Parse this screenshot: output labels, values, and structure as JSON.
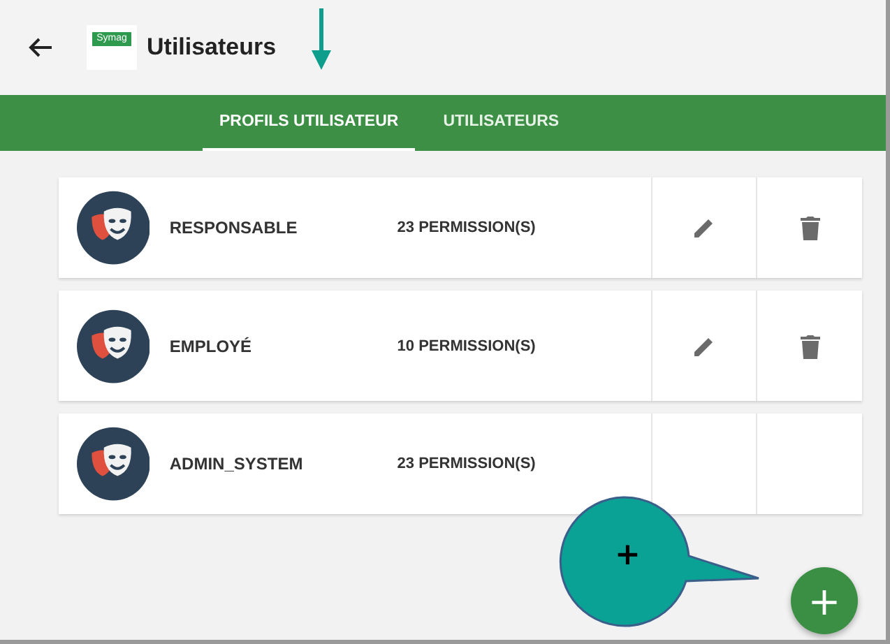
{
  "app_bar": {
    "logo_text": "Symag",
    "title": "Utilisateurs"
  },
  "tabs": [
    {
      "label": "PROFILS UTILISATEUR",
      "selected": true
    },
    {
      "label": "UTILISATEURS",
      "selected": false
    }
  ],
  "profiles": [
    {
      "name": "RESPONSABLE",
      "permissions": "23 PERMISSION(S)",
      "editable": true
    },
    {
      "name": "EMPLOYÉ",
      "permissions": "10 PERMISSION(S)",
      "editable": true
    },
    {
      "name": "ADMIN_SYSTEM",
      "permissions": "23 PERMISSION(S)",
      "editable": false
    }
  ],
  "fab": {
    "label": "+"
  },
  "callout": {
    "text": "+"
  }
}
